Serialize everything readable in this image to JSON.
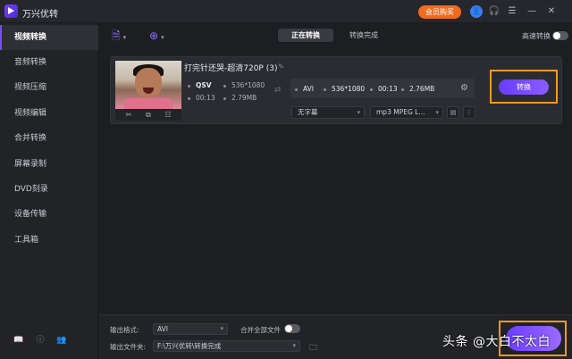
{
  "app": {
    "title": "万兴优转",
    "vip_label": "会员购买"
  },
  "sidebar": {
    "items": [
      {
        "label": "视频转换",
        "active": true
      },
      {
        "label": "音频转换"
      },
      {
        "label": "视频压缩"
      },
      {
        "label": "视频编辑"
      },
      {
        "label": "合并转换"
      },
      {
        "label": "屏幕录制"
      },
      {
        "label": "DVD刻录"
      },
      {
        "label": "设备传输"
      },
      {
        "label": "工具箱"
      }
    ]
  },
  "tabs": {
    "converting": "正在转换",
    "done": "转换完成"
  },
  "fast_convert_label": "高速转换",
  "task": {
    "filename": "打完针还哭-超清720P (3)",
    "source": {
      "codec": "QSV",
      "resolution": "536*1080",
      "duration": "00:13",
      "size": "2.79MB"
    },
    "target": {
      "format": "AVI",
      "resolution": "536*1080",
      "duration": "00:13",
      "size": "2.76MB"
    },
    "subtitle": "无字幕",
    "audio": "mp3 MPEG L...",
    "convert_label": "转换"
  },
  "footer": {
    "format_label": "输出格式:",
    "format_value": "AVI",
    "merge_label": "合并全部文件",
    "folder_label": "输出文件夹:",
    "folder_value": "F:\\万兴优转\\转换完成"
  },
  "watermark": "头条 @大白不太白"
}
